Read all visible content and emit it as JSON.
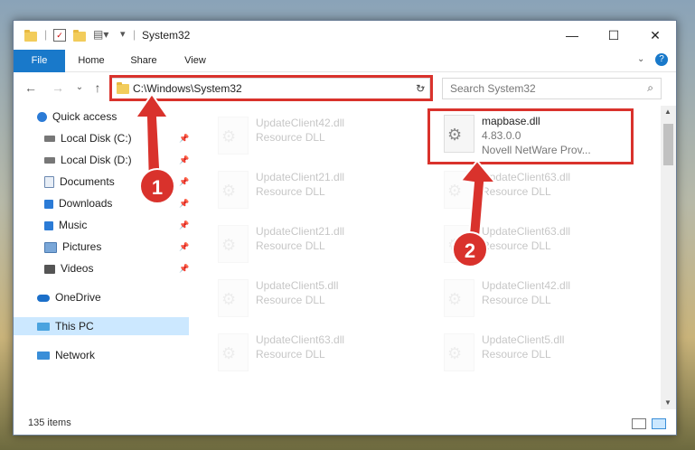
{
  "window": {
    "title": "System32"
  },
  "ribbon": {
    "tabs": [
      "File",
      "Home",
      "Share",
      "View"
    ]
  },
  "address": {
    "path": "C:\\Windows\\System32"
  },
  "search": {
    "placeholder": "Search System32"
  },
  "nav": {
    "items": [
      {
        "label": "Quick access"
      },
      {
        "label": "Local Disk (C:)"
      },
      {
        "label": "Local Disk (D:)"
      },
      {
        "label": "Documents"
      },
      {
        "label": "Downloads"
      },
      {
        "label": "Music"
      },
      {
        "label": "Pictures"
      },
      {
        "label": "Videos"
      },
      {
        "label": "OneDrive"
      },
      {
        "label": "This PC"
      },
      {
        "label": "Network"
      }
    ]
  },
  "files": {
    "active": {
      "name": "mapbase.dll",
      "version": "4.83.0.0",
      "desc": "Novell NetWare Prov..."
    },
    "items": [
      {
        "name": "UpdateClient42.dll",
        "desc": "Resource DLL"
      },
      {
        "name": "UpdateClient21.dll",
        "desc": "Resource DLL"
      },
      {
        "name": "UpdateClient63.dll",
        "desc": "Resource DLL"
      },
      {
        "name": "UpdateClient21.dll",
        "desc": "Resource DLL"
      },
      {
        "name": "UpdateClient63.dll",
        "desc": "Resource DLL"
      },
      {
        "name": "UpdateClient5.dll",
        "desc": "Resource DLL"
      },
      {
        "name": "UpdateClient42.dll",
        "desc": "Resource DLL"
      },
      {
        "name": "UpdateClient63.dll",
        "desc": "Resource DLL"
      },
      {
        "name": "UpdateClient5.dll",
        "desc": "Resource DLL"
      }
    ]
  },
  "status": {
    "count": "135 items"
  },
  "annotations": {
    "step1": "1",
    "step2": "2"
  },
  "colors": {
    "accent": "#1979ca",
    "highlight": "#d9322c"
  }
}
